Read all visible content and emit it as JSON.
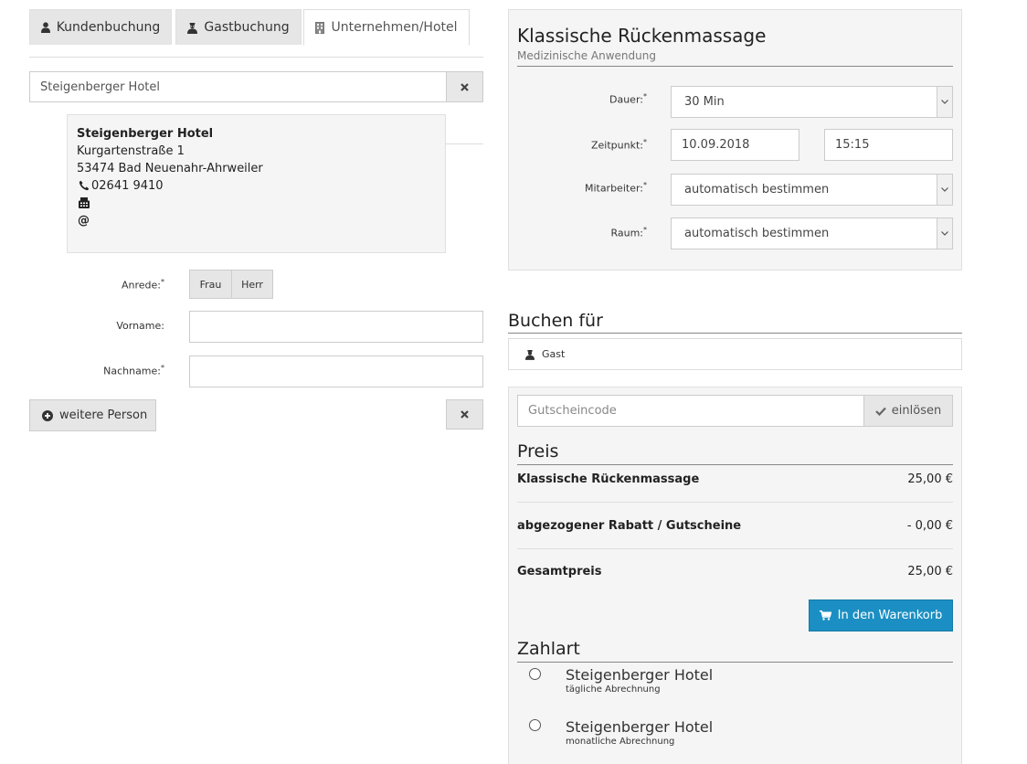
{
  "tabs": [
    {
      "label": "Kundenbuchung",
      "icon": "user-icon",
      "active": false
    },
    {
      "label": "Gastbuchung",
      "icon": "guest-icon",
      "active": false
    },
    {
      "label": "Unternehmen/Hotel",
      "icon": "building-icon",
      "active": true
    }
  ],
  "company": {
    "search_value": "Steigenberger Hotel",
    "card": {
      "name": "Steigenberger Hotel",
      "street": "Kurgartenstraße 1",
      "city": "53474 Bad Neuenahr-Ahrweiler",
      "phone": "02641 9410",
      "fax": "",
      "email": ""
    }
  },
  "person_form": {
    "salutation_label": "Anrede:",
    "salutation_options": [
      "Frau",
      "Herr"
    ],
    "firstname_label": "Vorname:",
    "firstname_value": "",
    "lastname_label": "Nachname:",
    "lastname_value": "",
    "required_mark": "*",
    "add_person_label": "weitere Person"
  },
  "service": {
    "title": "Klassische Rückenmassage",
    "subtitle": "Medizinische Anwendung",
    "duration_label": "Dauer:",
    "duration_value": "30 Min",
    "time_label": "Zeitpunkt:",
    "date_value": "10.09.2018",
    "time_value": "15:15",
    "employee_label": "Mitarbeiter:",
    "employee_value": "automatisch bestimmen",
    "room_label": "Raum:",
    "room_value": "automatisch bestimmen"
  },
  "booking_for": {
    "title": "Buchen für",
    "value": "Gast"
  },
  "voucher": {
    "placeholder": "Gutscheincode",
    "button_label": "einlösen"
  },
  "price": {
    "title": "Preis",
    "rows": [
      {
        "label": "Klassische Rückenmassage",
        "value": "25,00 €"
      },
      {
        "label": "abgezogener Rabatt / Gutscheine",
        "value": "- 0,00 €"
      },
      {
        "label": "Gesamtpreis",
        "value": "25,00 €"
      }
    ],
    "cart_button_label": "In den Warenkorb"
  },
  "payment": {
    "title": "Zahlart",
    "options": [
      {
        "name": "Steigenberger Hotel",
        "sub": "tägliche Abrechnung"
      },
      {
        "name": "Steigenberger Hotel",
        "sub": "monatliche Abrechnung"
      }
    ]
  },
  "colors": {
    "primary_button": "#1b8fc3",
    "panel_background": "#f5f5f5"
  }
}
